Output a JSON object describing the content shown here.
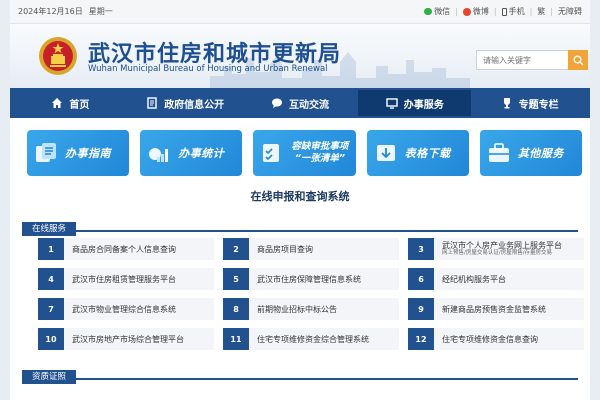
{
  "topbar": {
    "date": "2024年12月16日",
    "weekday": "星期一",
    "links": [
      {
        "label": "微信",
        "icon": "wechat-icon"
      },
      {
        "label": "微博",
        "icon": "weibo-icon"
      },
      {
        "label": "手机",
        "icon": "phone-icon"
      },
      {
        "label": "繁",
        "icon": ""
      },
      {
        "label": "无障碍",
        "icon": ""
      }
    ]
  },
  "header": {
    "title_zh": "武汉市住房和城市更新局",
    "title_en": "Wuhan Municipal Bureau of Housing and Urban Renewal",
    "search_placeholder": "请输入关键字"
  },
  "nav": {
    "items": [
      {
        "label": "首页",
        "icon": "home-icon"
      },
      {
        "label": "政府信息公开",
        "icon": "document-icon"
      },
      {
        "label": "互动交流",
        "icon": "chat-bubble-icon"
      },
      {
        "label": "办事服务",
        "icon": "monitor-icon"
      },
      {
        "label": "专题专栏",
        "icon": "trophy-icon"
      }
    ],
    "active_index": 3
  },
  "banners": [
    {
      "label": "办事指南",
      "icon": "guide-icon"
    },
    {
      "label": "办事统计",
      "icon": "statistics-icon"
    },
    {
      "label_line1": "容缺审批事项",
      "label_line2": "“一张清单”",
      "icon": "checklist-icon"
    },
    {
      "label": "表格下载",
      "icon": "download-icon"
    },
    {
      "label": "其他服务",
      "icon": "services-icon"
    }
  ],
  "section_title": "在线申报和查询系统",
  "tab_online": "在线服务",
  "services": [
    {
      "num": "1",
      "label": "商品房合同备案个人信息查询"
    },
    {
      "num": "2",
      "label": "商品房项目查询"
    },
    {
      "num": "3",
      "label": "武汉市个人房产业务网上服务平台",
      "sub": "网上预售/房屋交易认证/房屋限售/存量房交易"
    },
    {
      "num": "4",
      "label": "武汉市住房租赁管理服务平台"
    },
    {
      "num": "5",
      "label": "武汉市住房保障管理信息系统"
    },
    {
      "num": "6",
      "label": "经纪机构服务平台"
    },
    {
      "num": "7",
      "label": "武汉市物业管理综合信息系统"
    },
    {
      "num": "8",
      "label": "前期物业招标中标公告"
    },
    {
      "num": "9",
      "label": "新建商品房预售资金监管系统"
    },
    {
      "num": "10",
      "label": "武汉市房地产市场综合管理平台"
    },
    {
      "num": "11",
      "label": "住宅专项维修资金综合管理系统"
    },
    {
      "num": "12",
      "label": "住宅专项维修资金信息查询"
    }
  ],
  "tab_cert": "资质证照",
  "colors": {
    "primary": "#225190",
    "banner": "#2a93df",
    "search_button": "#f0a43a"
  }
}
